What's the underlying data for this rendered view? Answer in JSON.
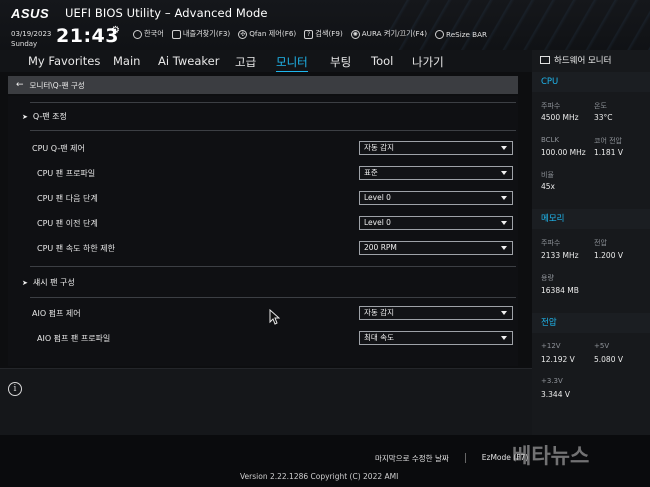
{
  "header": {
    "brand": "ASUS",
    "title": "UEFI BIOS Utility – Advanced Mode",
    "date": "03/19/2023",
    "day": "Sunday",
    "time": "21:43",
    "toolbar": [
      {
        "icon": "globe-icon",
        "label": "한국어"
      },
      {
        "icon": "favorite-icon",
        "label": "내즐겨찾기(F3)"
      },
      {
        "icon": "fan-icon",
        "label": "Qfan 제어(F6)"
      },
      {
        "icon": "search-icon",
        "label": "검색(F9)"
      },
      {
        "icon": "aura-icon",
        "label": "AURA 켜기/끄기(F4)"
      },
      {
        "icon": "resize-bar-icon",
        "label": "ReSize BAR"
      }
    ]
  },
  "nav": {
    "tabs": [
      "My Favorites",
      "Main",
      "Ai Tweaker",
      "고급",
      "모니터",
      "부팅",
      "Tool",
      "나가기"
    ],
    "active": "모니터"
  },
  "breadcrumb": "모니터\\Q-팬 구성",
  "main": {
    "section1": "Q-팬 조정",
    "cpu_fan_control": {
      "label": "CPU Q-팬 제어",
      "value": "자동 감지"
    },
    "cpu_fan_profile": {
      "label": "CPU 팬 프로파일",
      "value": "표준"
    },
    "cpu_fan_step_up": {
      "label": "CPU 팬 다음 단계",
      "value": "Level 0"
    },
    "cpu_fan_step_down": {
      "label": "CPU 팬 이전 단계",
      "value": "Level 0"
    },
    "cpu_fan_speed_low": {
      "label": "CPU 팬 속도 하한 제한",
      "value": "200 RPM"
    },
    "section2": "섀시 팬 구성",
    "aio_pump_control": {
      "label": "AIO 펌프 제어",
      "value": "자동 감지"
    },
    "aio_pump_profile": {
      "label": "AIO 펌프 팬 프로파일",
      "value": "최대 속도"
    }
  },
  "hw_monitor": {
    "title": "하드웨어 모니터",
    "cpu": {
      "heading": "CPU",
      "freq_label": "주파수",
      "freq_value": "4500 MHz",
      "temp_label": "온도",
      "temp_value": "33°C",
      "bclk_label": "BCLK",
      "bclk_value": "100.00 MHz",
      "vcore_label": "코어 전압",
      "vcore_value": "1.181 V",
      "ratio_label": "비율",
      "ratio_value": "45x"
    },
    "memory": {
      "heading": "메모리",
      "freq_label": "주파수",
      "freq_value": "2133 MHz",
      "volt_label": "전압",
      "volt_value": "1.200 V",
      "cap_label": "용량",
      "cap_value": "16384 MB"
    },
    "voltage": {
      "heading": "전압",
      "v12_label": "+12V",
      "v12_value": "12.192 V",
      "v5_label": "+5V",
      "v5_value": "5.080 V",
      "v33_label": "+3.3V",
      "v33_value": "3.344 V"
    }
  },
  "footer": {
    "last_modified": "마지막으로 수정한 날짜",
    "ezmode": "EzMode (F7)",
    "version": "Version 2.22.1286 Copyright (C) 2022 AMI"
  },
  "watermark": "베타뉴스",
  "colors": {
    "accent": "#1fb7ee",
    "background": "#0d0e10"
  }
}
